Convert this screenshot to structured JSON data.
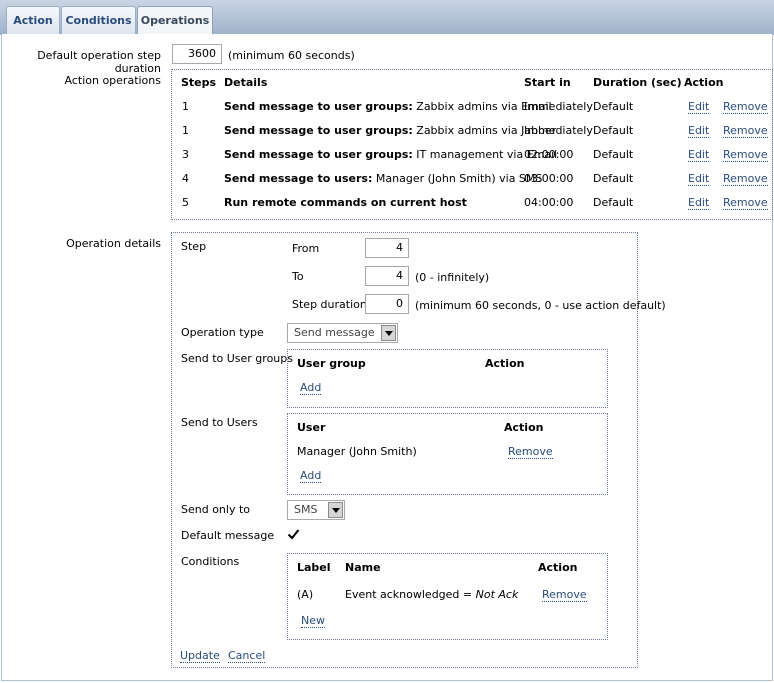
{
  "tabs": [
    "Action",
    "Conditions",
    "Operations"
  ],
  "default_step": {
    "label": "Default operation step duration",
    "value": "3600",
    "hint": "(minimum 60 seconds)"
  },
  "action_operations": {
    "label": "Action operations",
    "headers": {
      "steps": "Steps",
      "details": "Details",
      "start_in": "Start in",
      "duration": "Duration (sec)",
      "action": "Action"
    },
    "rows": [
      {
        "steps": "1",
        "detail_bold": "Send message to user groups:",
        "detail_rest": " Zabbix admins via Email",
        "start_in": "Immediately",
        "duration": "Default",
        "edit": "Edit",
        "remove": "Remove"
      },
      {
        "steps": "1",
        "detail_bold": "Send message to user groups:",
        "detail_rest": " Zabbix admins via Jabber",
        "start_in": "Immediately",
        "duration": "Default",
        "edit": "Edit",
        "remove": "Remove"
      },
      {
        "steps": "3",
        "detail_bold": "Send message to user groups:",
        "detail_rest": " IT management via Email",
        "start_in": "02:00:00",
        "duration": "Default",
        "edit": "Edit",
        "remove": "Remove"
      },
      {
        "steps": "4",
        "detail_bold": "Send message to users:",
        "detail_rest": " Manager (John Smith) via SMS",
        "start_in": "03:00:00",
        "duration": "Default",
        "edit": "Edit",
        "remove": "Remove"
      },
      {
        "steps": "5",
        "detail_bold": "Run remote commands on current host",
        "detail_rest": "",
        "start_in": "04:00:00",
        "duration": "Default",
        "edit": "Edit",
        "remove": "Remove"
      }
    ]
  },
  "operation_details": {
    "label": "Operation details",
    "step_label": "Step",
    "from_label": "From",
    "from_value": "4",
    "to_label": "To",
    "to_value": "4",
    "to_hint": "(0 - infinitely)",
    "step_duration_label": "Step duration",
    "step_duration_value": "0",
    "step_duration_hint": "(minimum 60 seconds, 0 - use action default)",
    "operation_type_label": "Operation type",
    "operation_type_value": "Send message",
    "send_groups_label": "Send to User groups",
    "groups_headers": {
      "group": "User group",
      "action": "Action"
    },
    "groups_add": "Add",
    "send_users_label": "Send to Users",
    "users_headers": {
      "user": "User",
      "action": "Action"
    },
    "users_row": {
      "user": "Manager (John Smith)",
      "remove": "Remove"
    },
    "users_add": "Add",
    "send_only_label": "Send only to",
    "send_only_value": "SMS",
    "default_message_label": "Default message",
    "default_message_checked": true,
    "conditions_label": "Conditions",
    "cond_headers": {
      "label": "Label",
      "name": "Name",
      "action": "Action"
    },
    "cond_row": {
      "label": "(A)",
      "name_prefix": "Event acknowledged = ",
      "name_italic": "Not Ack",
      "remove": "Remove"
    },
    "cond_new": "New",
    "update": "Update",
    "cancel": "Cancel"
  }
}
